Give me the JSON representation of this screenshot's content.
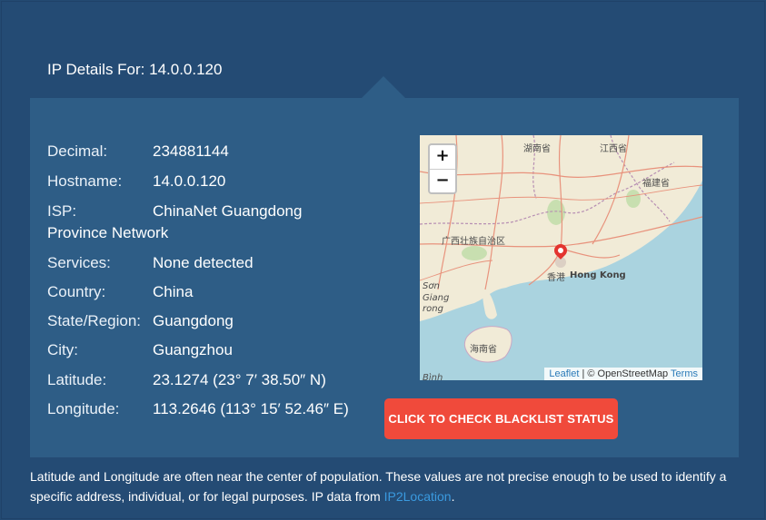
{
  "header": {
    "title": "IP Details For: 14.0.0.120"
  },
  "details": [
    {
      "label": "Decimal:",
      "value": "234881144"
    },
    {
      "label": "Hostname:",
      "value": "14.0.0.120"
    },
    {
      "label": "ISP:",
      "value": "ChinaNet Guangdong",
      "value_cont": "Province Network"
    },
    {
      "label": "Services:",
      "value": "None detected"
    },
    {
      "label": "Country:",
      "value": "China"
    },
    {
      "label": "State/Region:",
      "value": "Guangdong"
    },
    {
      "label": "City:",
      "value": "Guangzhou"
    },
    {
      "label": "Latitude:",
      "value": "23.1274  (23° 7′ 38.50″ N)"
    },
    {
      "label": "Longitude:",
      "value": "113.2646  (113° 15′ 52.46″ E)"
    }
  ],
  "map": {
    "zoom_in": "+",
    "zoom_out": "−",
    "attribution_link": "Leaflet",
    "attribution_sep": " | © OpenStreetMap ",
    "attribution_terms": "Terms",
    "labels": {
      "hunan": "湖南省",
      "jiangxi": "江西省",
      "fujian": "福建省",
      "guangxi": "广西壮族自治区",
      "hk_cn": "香港",
      "hk_en": "Hong Kong",
      "hainan": "海南省",
      "son": "Sơn",
      "giang": "Giang",
      "rong": "rong",
      "binh": "Bình"
    }
  },
  "actions": {
    "blacklist_button": "CLICK TO CHECK BLACKLIST STATUS"
  },
  "footer": {
    "note": "Latitude and Longitude are often near the center of population. These values are not precise enough to be used to identify a specific address, individual, or for legal purposes. IP data from ",
    "link": "IP2Location",
    "end": "."
  }
}
